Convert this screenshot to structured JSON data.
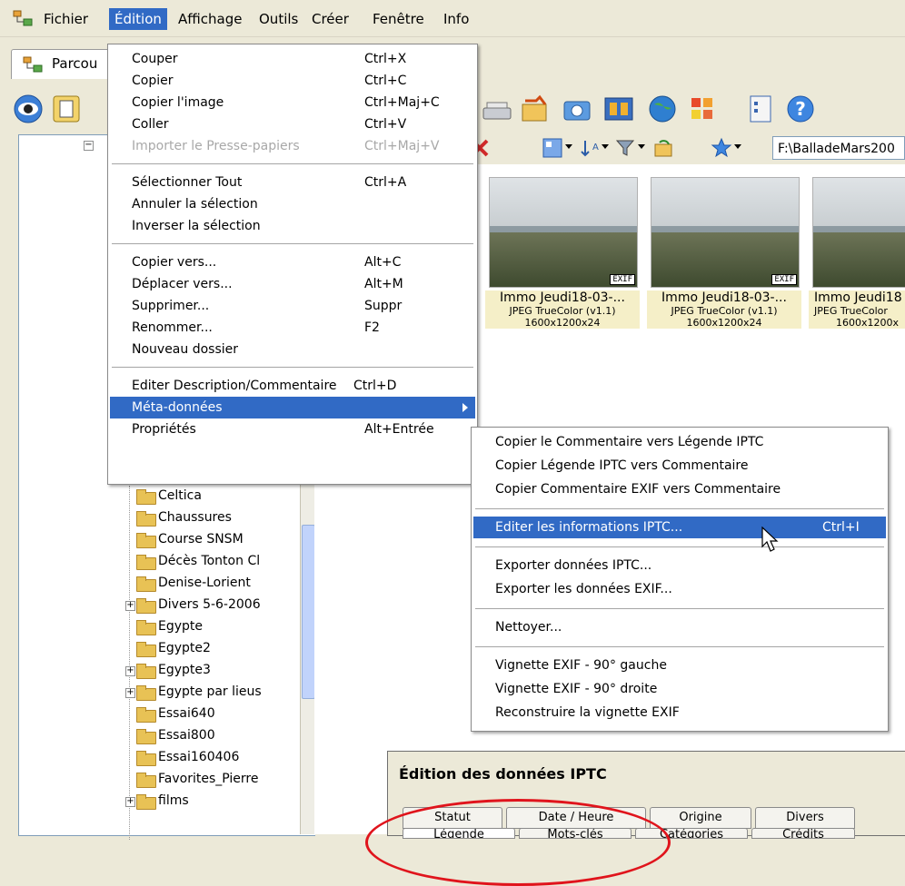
{
  "menubar": {
    "items": [
      "Fichier",
      "Édition",
      "Affichage",
      "Outils",
      "Créer",
      "Fenêtre",
      "Info"
    ]
  },
  "tab": {
    "label": "Parcou"
  },
  "path": {
    "value": "F:\\BalladeMars200"
  },
  "edit_menu": {
    "items": [
      {
        "label": "Couper",
        "accel": "Ctrl+X"
      },
      {
        "label": "Copier",
        "accel": "Ctrl+C"
      },
      {
        "label": "Copier l'image",
        "accel": "Ctrl+Maj+C"
      },
      {
        "label": "Coller",
        "accel": "Ctrl+V"
      },
      {
        "label": "Importer le Presse-papiers",
        "accel": "Ctrl+Maj+V"
      },
      {
        "label": "Sélectionner Tout",
        "accel": "Ctrl+A"
      },
      {
        "label": "Annuler la sélection",
        "accel": ""
      },
      {
        "label": "Inverser la sélection",
        "accel": ""
      },
      {
        "label": "Copier vers...",
        "accel": "Alt+C"
      },
      {
        "label": "Déplacer vers...",
        "accel": "Alt+M"
      },
      {
        "label": "Supprimer...",
        "accel": "Suppr"
      },
      {
        "label": "Renommer...",
        "accel": "F2"
      },
      {
        "label": "Nouveau dossier",
        "accel": ""
      },
      {
        "label": "Editer Description/Commentaire",
        "accel": "Ctrl+D"
      },
      {
        "label": "Méta-données",
        "accel": ""
      },
      {
        "label": "Propriétés",
        "accel": "Alt+Entrée"
      }
    ]
  },
  "meta_submenu": {
    "items": [
      {
        "label": "Copier le Commentaire vers Légende IPTC",
        "accel": ""
      },
      {
        "label": "Copier Légende IPTC vers Commentaire",
        "accel": ""
      },
      {
        "label": "Copier Commentaire EXIF vers Commentaire",
        "accel": ""
      },
      {
        "label": "Editer les informations IPTC...",
        "accel": "Ctrl+I"
      },
      {
        "label": "Exporter données IPTC...",
        "accel": ""
      },
      {
        "label": "Exporter les données EXIF...",
        "accel": ""
      },
      {
        "label": "Nettoyer...",
        "accel": ""
      },
      {
        "label": "Vignette EXIF - 90° gauche",
        "accel": ""
      },
      {
        "label": "Vignette EXIF - 90° droite",
        "accel": ""
      },
      {
        "label": "Reconstruire la vignette EXIF",
        "accel": ""
      }
    ]
  },
  "thumbnails": [
    {
      "name": "Immo Jeudi18-03-...",
      "format": "JPEG TrueColor (v1.1)",
      "size": "1600x1200x24",
      "badge": "EXIF"
    },
    {
      "name": "Immo Jeudi18-03-...",
      "format": "JPEG TrueColor (v1.1)",
      "size": "1600x1200x24",
      "badge": "EXIF"
    },
    {
      "name": "Immo Jeudi18",
      "format": "JPEG TrueColor",
      "size": "1600x1200x",
      "badge": ""
    }
  ],
  "tree": {
    "items": [
      "Celtica",
      "Chaussures",
      "Course SNSM",
      "Décès Tonton Cl",
      "Denise-Lorient",
      "Divers 5-6-2006",
      "Egypte",
      "Egypte2",
      "Egypte3",
      "Egypte par lieus",
      "Essai640",
      "Essai800",
      "Essai160406",
      "Favorites_Pierre",
      "films"
    ]
  },
  "dialog": {
    "title": "Édition des données IPTC",
    "tabs_row1": [
      "Statut",
      "Date / Heure",
      "Origine",
      "Divers"
    ],
    "tabs_row2": [
      "Légende",
      "Mots-clés",
      "Catégories",
      "Crédits"
    ]
  },
  "colors": {
    "highlight": "#316ac5",
    "annotation": "#e0141c"
  }
}
